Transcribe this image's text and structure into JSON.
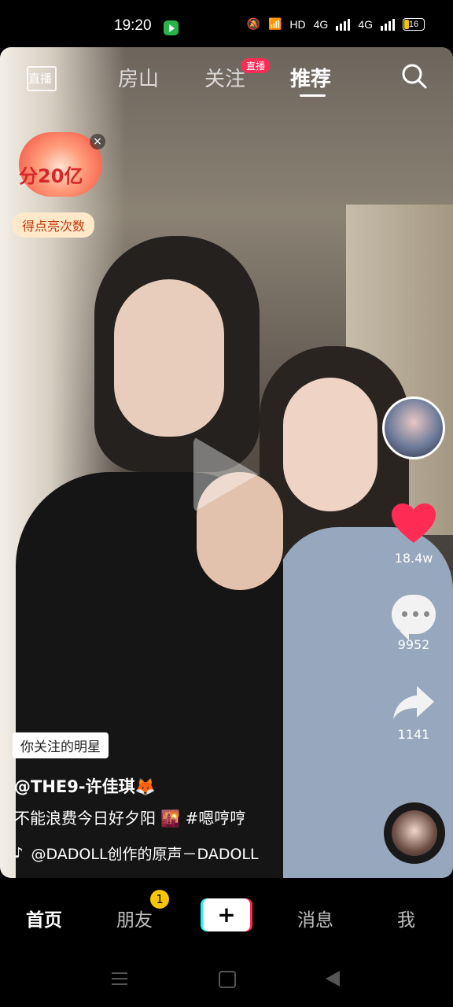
{
  "status_bar": {
    "time": "19:20",
    "network_label": "HD",
    "signal_1": "4G",
    "signal_2": "4G",
    "battery": "16"
  },
  "top_nav": {
    "live_label": "直播",
    "tabs": [
      "房山",
      "关注",
      "推荐"
    ],
    "active_tab": "推荐",
    "live_badge": "直播"
  },
  "promo": {
    "amount": "分20亿",
    "close": "×",
    "pill": "得点亮次数"
  },
  "sidebar": {
    "likes": "18.4w",
    "comments": "9952",
    "shares": "1141"
  },
  "caption": {
    "follow_tag": "你关注的明星",
    "author": "@THE9-许佳琪🦊",
    "description": "不能浪费今日好夕阳 🌇 #嗯哼哼",
    "music": "@DADOLL创作的原声－DADOLL"
  },
  "bottom_nav": {
    "items": [
      "首页",
      "朋友",
      "消息",
      "我"
    ],
    "friends_badge": "1",
    "create": "+"
  },
  "colors": {
    "like_red": "#fe2c55",
    "badge_yellow": "#f7c600"
  }
}
